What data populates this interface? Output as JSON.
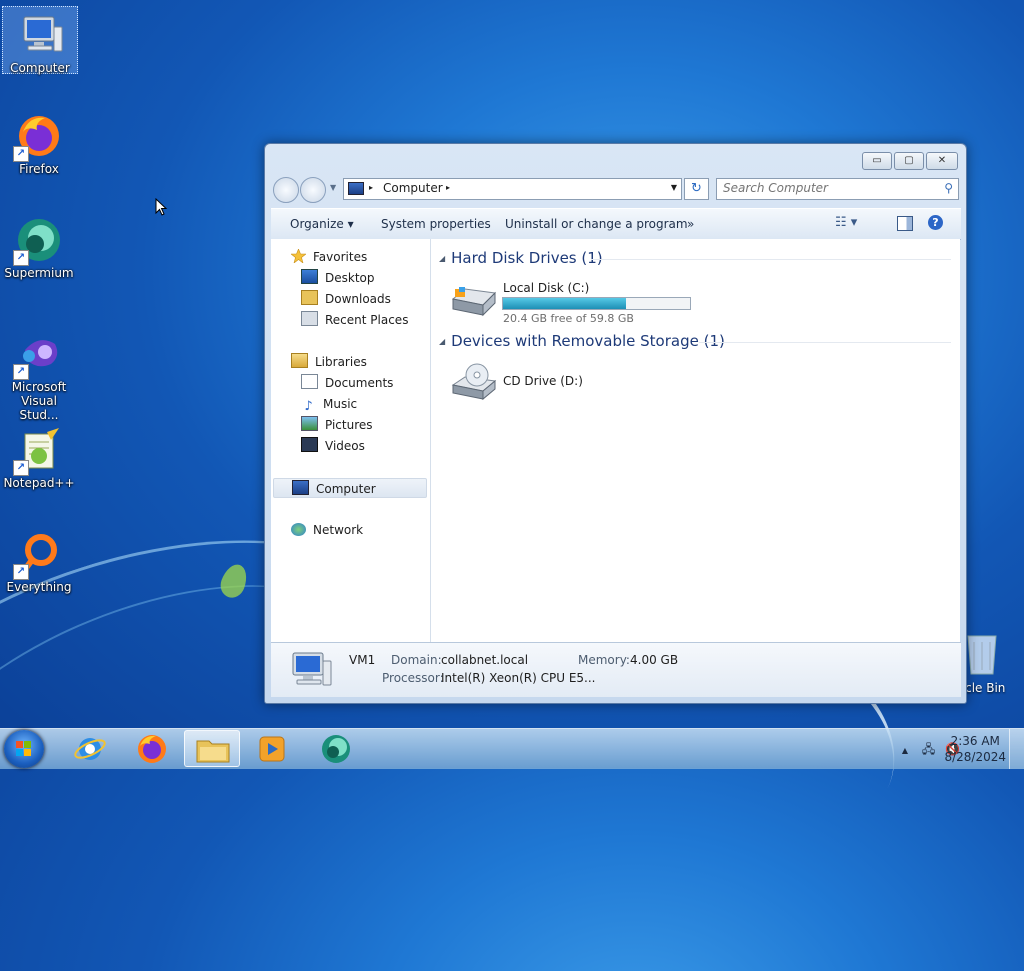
{
  "desktop": {
    "icons": [
      {
        "label": "Computer",
        "icon": "computer-icon"
      },
      {
        "label": "Firefox",
        "icon": "firefox-icon"
      },
      {
        "label": "Supermium",
        "icon": "supermium-icon"
      },
      {
        "label_line1": "Microsoft",
        "label_line2": "Visual Stud...",
        "icon": "visual-studio-icon"
      },
      {
        "label": "Notepad++",
        "icon": "notepadpp-icon"
      },
      {
        "label": "Everything",
        "icon": "everything-icon"
      }
    ],
    "recycle_bin_label": "ycle Bin"
  },
  "window": {
    "caption_buttons": {
      "minimize": "▭",
      "maximize": "▢",
      "close": "✕"
    },
    "address": {
      "crumb": "Computer",
      "separator": "▸",
      "dropdown": "▼"
    },
    "refresh_glyph": "↻",
    "search": {
      "placeholder": "Search Computer",
      "icon": "search-icon"
    },
    "toolbar": {
      "organize": "Organize ▾",
      "system_properties": "System properties",
      "uninstall": "Uninstall or change a program",
      "more": "»",
      "help": "?"
    },
    "nav": {
      "favorites": "Favorites",
      "desktop": "Desktop",
      "downloads": "Downloads",
      "recent_places": "Recent Places",
      "libraries": "Libraries",
      "documents": "Documents",
      "music": "Music",
      "pictures": "Pictures",
      "videos": "Videos",
      "computer": "Computer",
      "network": "Network"
    },
    "groups": {
      "hdd_title": "Hard Disk Drives (1)",
      "removable_title": "Devices with Removable Storage (1)",
      "collapse_glyph": "◢"
    },
    "drives": {
      "c_name": "Local Disk (C:)",
      "c_free": "20.4 GB free of 59.8 GB",
      "c_used_fraction": 0.659,
      "d_name": "CD Drive (D:)"
    },
    "details": {
      "name": "VM1",
      "domain_label": "Domain:",
      "domain_value": "collabnet.local",
      "memory_label": "Memory:",
      "memory_value": "4.00 GB",
      "processor_label": "Processor:",
      "processor_value": "Intel(R) Xeon(R) CPU E5..."
    }
  },
  "taskbar": {
    "tray_arrow": "▲",
    "time": "2:36 AM",
    "date": "8/28/2024",
    "pinned": [
      "internet-explorer-icon",
      "firefox-icon",
      "file-explorer-icon",
      "media-player-icon",
      "supermium-icon"
    ]
  },
  "colors": {
    "accent": "#2c66c7",
    "group_header": "#1e3a78",
    "disk_bar": "#1d8fb5"
  }
}
